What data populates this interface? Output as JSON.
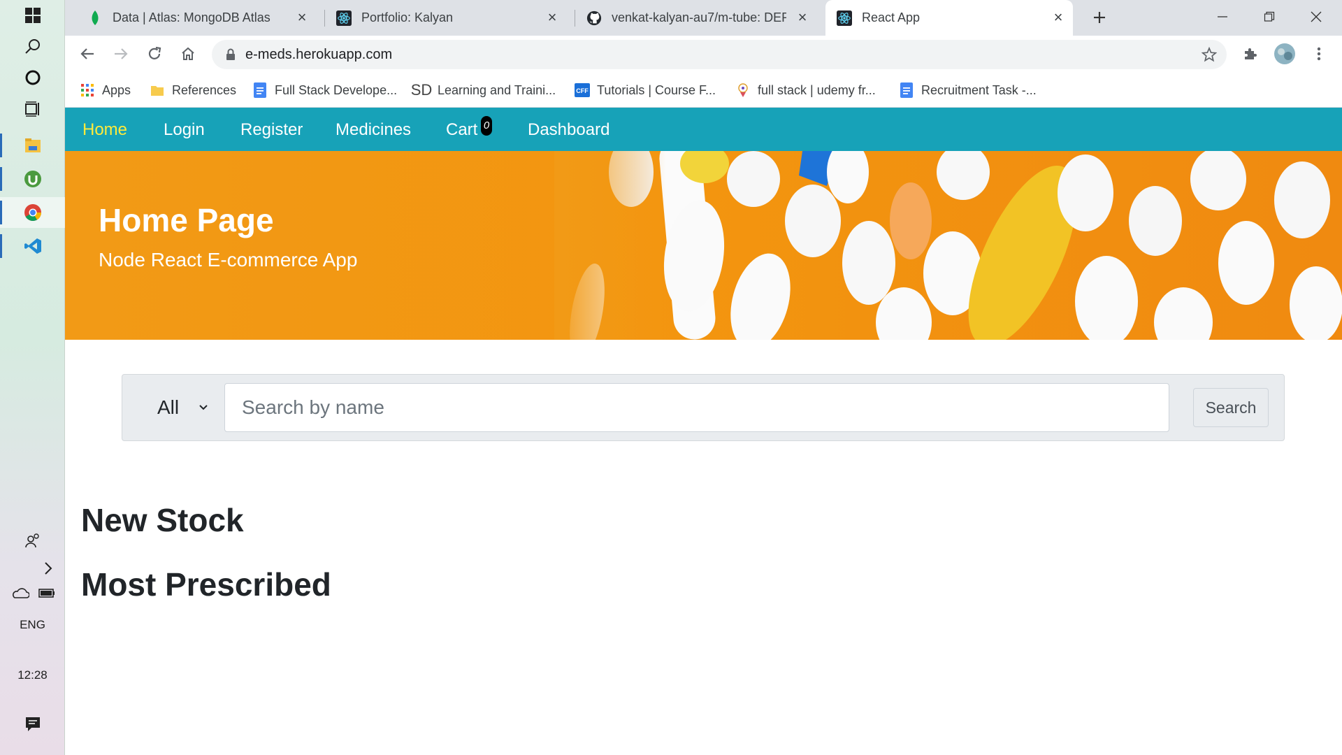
{
  "taskbar": {
    "language": "ENG",
    "time": "12:28"
  },
  "browser": {
    "tabs": [
      {
        "title": "Data | Atlas: MongoDB Atlas",
        "icon": "mongodb-leaf-icon"
      },
      {
        "title": "Portfolio: Kalyan",
        "icon": "react-icon"
      },
      {
        "title": "venkat-kalyan-au7/m-tube: DEPL",
        "icon": "github-icon"
      },
      {
        "title": "React App",
        "icon": "react-icon",
        "active": true
      }
    ],
    "url": "e-meds.herokuapp.com",
    "bookmarks": [
      {
        "label": "Apps",
        "icon": "apps-grid-icon"
      },
      {
        "label": "References",
        "icon": "folder-icon"
      },
      {
        "label": "Full Stack Develope...",
        "icon": "docs-icon"
      },
      {
        "label": "Learning and Traini...",
        "icon": "sd-icon"
      },
      {
        "label": "Tutorials | Course F...",
        "icon": "cff-icon"
      },
      {
        "label": "full stack | udemy fr...",
        "icon": "udemy-icon"
      },
      {
        "label": "Recruitment Task -...",
        "icon": "docs-icon"
      }
    ]
  },
  "site": {
    "nav": {
      "home": "Home",
      "login": "Login",
      "register": "Register",
      "medicines": "Medicines",
      "cart": "Cart",
      "cart_count": "0",
      "dashboard": "Dashboard"
    },
    "hero": {
      "title": "Home Page",
      "subtitle": "Node React E-commerce App"
    },
    "search": {
      "category": "All",
      "placeholder": "Search by name",
      "button": "Search"
    },
    "sections": {
      "new_stock": "New Stock",
      "most_prescribed": "Most Prescribed"
    }
  },
  "colors": {
    "navbar": "#17a2b8",
    "nav_active": "#ffeb3b",
    "hero_bg": "#f29a16"
  }
}
